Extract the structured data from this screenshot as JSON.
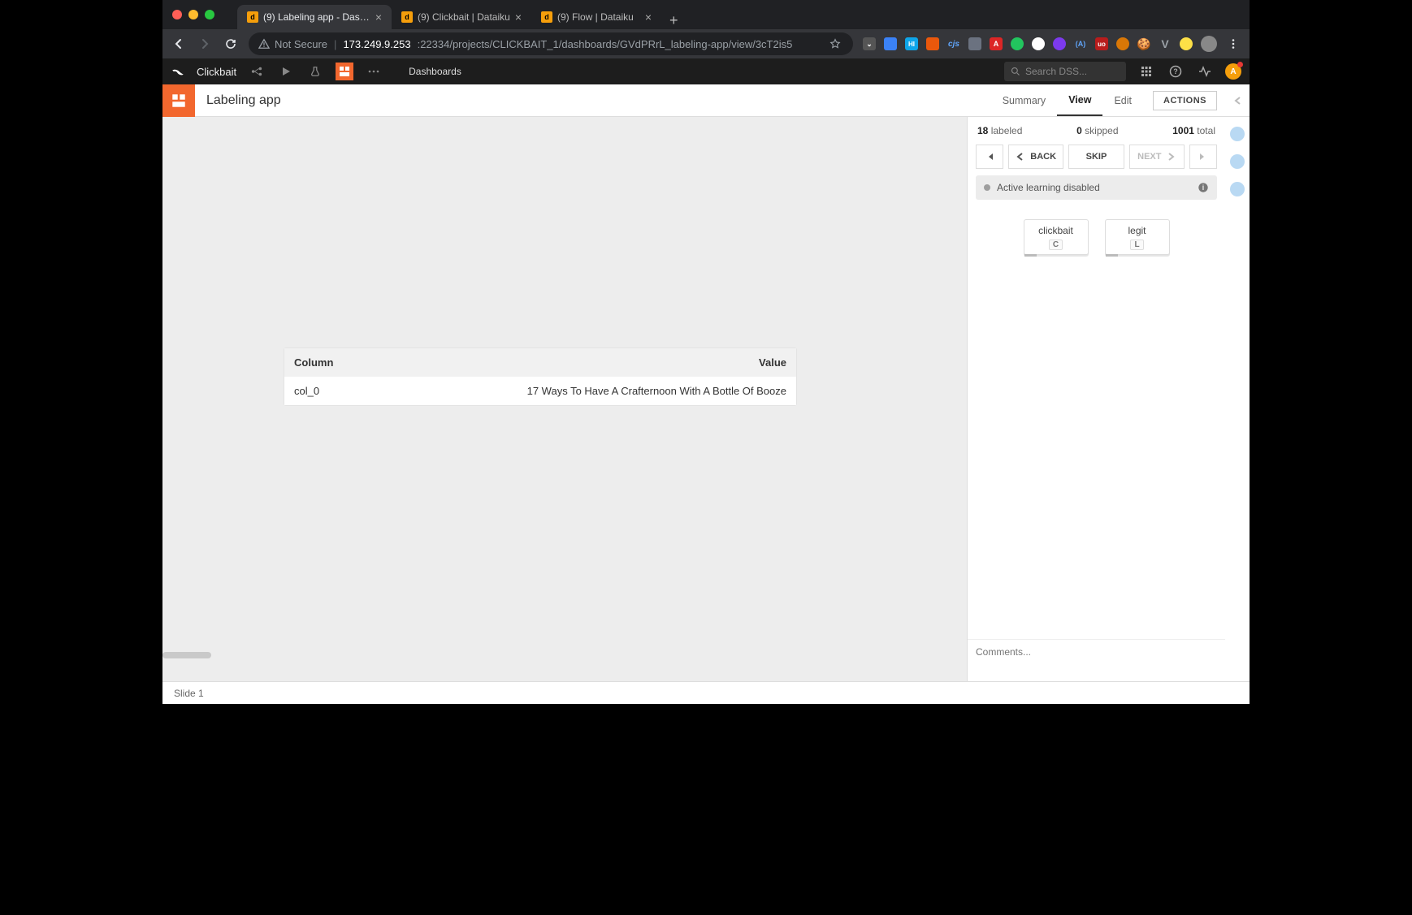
{
  "browser": {
    "tabs": [
      {
        "title": "(9) Labeling app - Dashboard",
        "active": true
      },
      {
        "title": "(9) Clickbait | Dataiku",
        "active": false
      },
      {
        "title": "(9) Flow | Dataiku",
        "active": false
      }
    ],
    "url": {
      "security": "Not Secure",
      "host": "173.249.9.253",
      "port_path": ":22334/projects/CLICKBAIT_1/dashboards/GVdPRrL_labeling-app/view/3cT2is5"
    }
  },
  "dss": {
    "project": "Clickbait",
    "breadcrumb": "Dashboards",
    "search_placeholder": "Search DSS..."
  },
  "page": {
    "title": "Labeling app",
    "tabs": {
      "summary": "Summary",
      "view": "View",
      "edit": "Edit"
    },
    "actions": "ACTIONS"
  },
  "record": {
    "headers": {
      "column": "Column",
      "value": "Value"
    },
    "row": {
      "column": "col_0",
      "value": "17 Ways To Have A Crafternoon With A Bottle Of Booze"
    }
  },
  "labeling": {
    "stats": {
      "labeled_n": "18",
      "labeled_t": "labeled",
      "skipped_n": "0",
      "skipped_t": "skipped",
      "total_n": "1001",
      "total_t": "total"
    },
    "nav": {
      "back": "BACK",
      "skip": "SKIP",
      "next": "NEXT"
    },
    "al_status": "Active learning disabled",
    "labels": [
      {
        "name": "clickbait",
        "key": "C"
      },
      {
        "name": "legit",
        "key": "L"
      }
    ],
    "comments_placeholder": "Comments..."
  },
  "footer": {
    "slide": "Slide 1"
  }
}
